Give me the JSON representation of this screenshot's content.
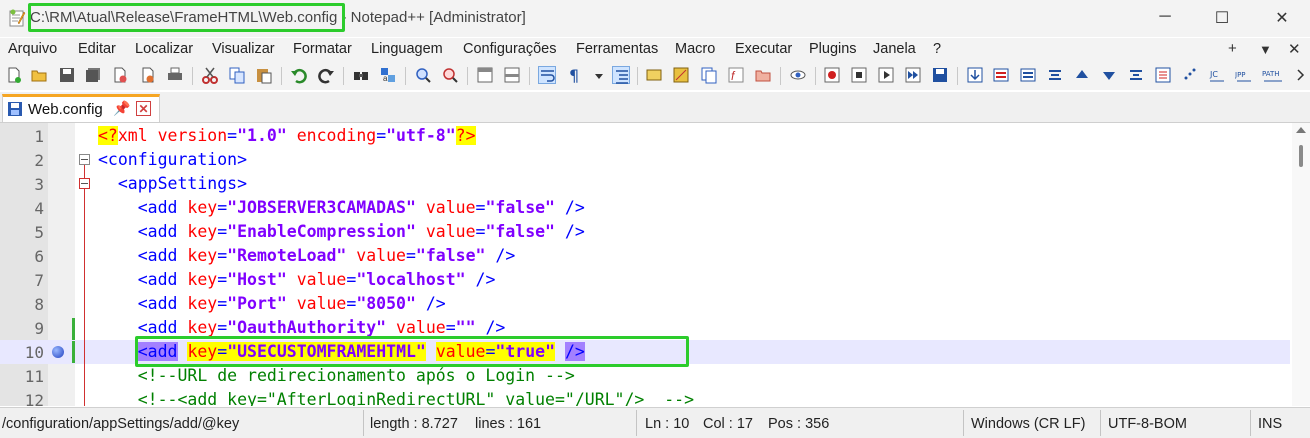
{
  "window": {
    "path": "C:\\RM\\Atual\\Release\\FrameHTML\\Web.config",
    "suffix": " - Notepad++ [Administrator]",
    "minimize": "─",
    "maximize": "☐",
    "close": "✕"
  },
  "menu": [
    "Arquivo",
    "Editar",
    "Localizar",
    "Visualizar",
    "Formatar",
    "Linguagem",
    "Configurações",
    "Ferramentas",
    "Macro",
    "Executar",
    "Plugins",
    "Janela",
    "?"
  ],
  "menu_right": [
    "+",
    "▼",
    "✕"
  ],
  "tab": {
    "label": "Web.config",
    "pin": "📌",
    "close": "✕"
  },
  "editor": {
    "lines": [
      "1",
      "2",
      "3",
      "4",
      "5",
      "6",
      "7",
      "8",
      "9",
      "10",
      "11",
      "12"
    ],
    "l1": {
      "open": "<?",
      "a": "xml ",
      "b": "version",
      "c": "=",
      "d": "\"1.0\"",
      "e": " encoding",
      "f": "=",
      "g": "\"utf-8\"",
      "close": "?>"
    },
    "l2": "<configuration>",
    "l3": "  <appSettings>",
    "l4": {
      "tag": "    <add ",
      "k": "key",
      "e1": "=",
      "v1": "\"JOBSERVER3CAMADAS\"",
      "k2": " value",
      "e2": "=",
      "v2": "\"false\"",
      "end": " />"
    },
    "l5": {
      "tag": "    <add ",
      "k": "key",
      "e1": "=",
      "v1": "\"EnableCompression\"",
      "k2": " value",
      "e2": "=",
      "v2": "\"false\"",
      "end": " />"
    },
    "l6": {
      "tag": "    <add ",
      "k": "key",
      "e1": "=",
      "v1": "\"RemoteLoad\"",
      "k2": " value",
      "e2": "=",
      "v2": "\"false\"",
      "end": " />"
    },
    "l7": {
      "tag": "    <add ",
      "k": "key",
      "e1": "=",
      "v1": "\"Host\"",
      "k2": " value",
      "e2": "=",
      "v2": "\"localhost\"",
      "end": " />"
    },
    "l8": {
      "tag": "    <add ",
      "k": "key",
      "e1": "=",
      "v1": "\"Port\"",
      "k2": " value",
      "e2": "=",
      "v2": "\"8050\"",
      "end": " />"
    },
    "l9": {
      "tag": "    <add ",
      "k": "key",
      "e1": "=",
      "v1": "\"OauthAuthority\"",
      "k2": " value",
      "e2": "=",
      "v2": "\"\"",
      "end": " />"
    },
    "l10": {
      "indent": "    ",
      "tag": "<add",
      "sp": " ",
      "k": "key",
      "e1": "=",
      "v1": "\"USECUSTOMFRAMEHTML\"",
      "sp2": " ",
      "k2": "value",
      "e2": "=",
      "v2": "\"true\"",
      "sp3": " ",
      "end": "/>"
    },
    "l11": "    <!--URL de redirecionamento após o Login -->",
    "l12": "    <!--<add key=\"AfterLoginRedirectURL\" value=\"/URL\"/>  -->"
  },
  "status": {
    "path": "/configuration/appSettings/add/@key",
    "length": "length : 8.727",
    "lines": "lines : 161",
    "ln": "Ln : 10",
    "col": "Col : 17",
    "pos": "Pos : 356",
    "eol": "Windows (CR LF)",
    "encoding": "UTF-8-BOM",
    "mode": "INS"
  },
  "colors": {
    "highlight": "#2ccc2c",
    "tag": "#0000ff",
    "attr": "#ff0000",
    "value": "#8000ff",
    "comment": "#008000"
  }
}
